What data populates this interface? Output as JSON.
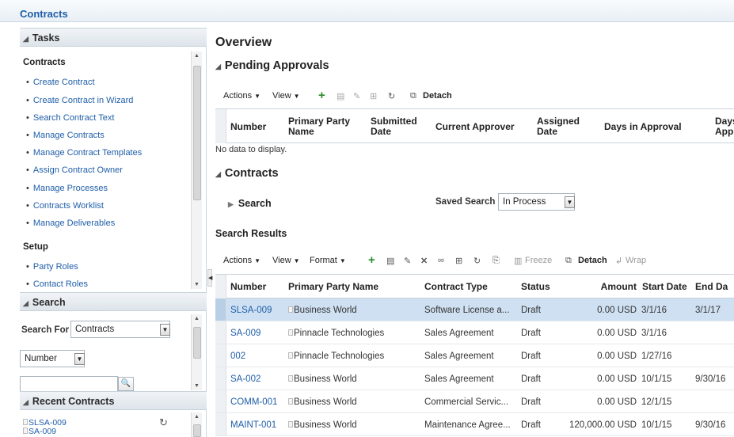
{
  "app": {
    "title": "Contracts"
  },
  "tasks": {
    "header": "Tasks",
    "contracts_section": "Contracts",
    "contracts_items": [
      "Create Contract",
      "Create Contract in Wizard",
      "Search Contract Text",
      "Manage Contracts",
      "Manage Contract Templates",
      "Assign Contract Owner",
      "Manage Processes",
      "Contracts Worklist",
      "Manage Deliverables"
    ],
    "setup_section": "Setup",
    "setup_items": [
      "Party Roles",
      "Contact Roles"
    ]
  },
  "search_panel": {
    "header": "Search",
    "search_for_label": "Search For",
    "search_for_value": "Contracts",
    "field_value": "Number",
    "input_value": ""
  },
  "recent": {
    "header": "Recent Contracts",
    "items": [
      "SLSA-009",
      "SA-009"
    ]
  },
  "main": {
    "overview_title": "Overview",
    "pending": {
      "title": "Pending Approvals",
      "toolbar": {
        "actions": "Actions",
        "view": "View",
        "detach": "Detach"
      },
      "columns": [
        "Number",
        "Primary Party Name",
        "Submitted Date",
        "Current Approver",
        "Assigned Date",
        "Days in Approval",
        "Days Appr"
      ],
      "empty": "No data to display."
    },
    "contracts": {
      "title": "Contracts",
      "search_toggle": "Search",
      "saved_search_label": "Saved Search",
      "saved_search_value": "In Process",
      "results_title": "Search Results",
      "toolbar": {
        "actions": "Actions",
        "view": "View",
        "format": "Format",
        "freeze": "Freeze",
        "detach": "Detach",
        "wrap": "Wrap"
      },
      "columns": [
        "Number",
        "Primary Party Name",
        "Contract Type",
        "Status",
        "Amount",
        "Start Date",
        "End Da"
      ],
      "rows": [
        {
          "number": "SLSA-009",
          "party": "Business World",
          "type": "Software License a...",
          "status": "Draft",
          "amount": "0.00 USD",
          "start": "3/1/16",
          "end": "3/1/17"
        },
        {
          "number": "SA-009",
          "party": "Pinnacle Technologies",
          "type": "Sales Agreement",
          "status": "Draft",
          "amount": "0.00 USD",
          "start": "3/1/16",
          "end": ""
        },
        {
          "number": "002",
          "party": "Pinnacle Technologies",
          "type": "Sales Agreement",
          "status": "Draft",
          "amount": "0.00 USD",
          "start": "1/27/16",
          "end": ""
        },
        {
          "number": "SA-002",
          "party": "Business World",
          "type": "Sales Agreement",
          "status": "Draft",
          "amount": "0.00 USD",
          "start": "10/1/15",
          "end": "9/30/16"
        },
        {
          "number": "COMM-001",
          "party": "Business World",
          "type": "Commercial Servic...",
          "status": "Draft",
          "amount": "0.00 USD",
          "start": "12/1/15",
          "end": ""
        },
        {
          "number": "MAINT-001",
          "party": "Business World",
          "type": "Maintenance Agree...",
          "status": "Draft",
          "amount": "120,000.00 USD",
          "start": "10/1/15",
          "end": "9/30/16"
        }
      ]
    }
  }
}
